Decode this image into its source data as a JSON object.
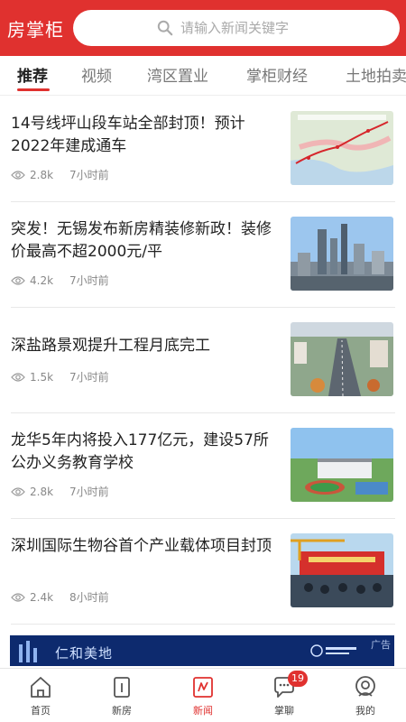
{
  "header": {
    "title": "房掌柜",
    "search_placeholder": "请输入新闻关键字"
  },
  "tabs": [
    {
      "label": "推荐",
      "active": true
    },
    {
      "label": "视频"
    },
    {
      "label": "湾区置业"
    },
    {
      "label": "掌柜财经"
    },
    {
      "label": "土地拍卖"
    }
  ],
  "articles": [
    {
      "title": "14号线坪山段车站全部封顶！预计2022年建成通车",
      "views": "2.8k",
      "time": "7小时前",
      "image": "map-thumbnail"
    },
    {
      "title": "突发！无锡发布新房精装修新政！装修价最高不超2000元/平",
      "views": "4.2k",
      "time": "7小时前",
      "image": "city-skyline-thumbnail"
    },
    {
      "title": "深盐路景观提升工程月底完工",
      "views": "1.5k",
      "time": "7小时前",
      "image": "road-aerial-thumbnail"
    },
    {
      "title": "龙华5年内将投入177亿元，建设57所公办义务教育学校",
      "views": "2.8k",
      "time": "7小时前",
      "image": "school-aerial-thumbnail"
    },
    {
      "title": "深圳国际生物谷首个产业载体项目封顶",
      "views": "2.4k",
      "time": "8小时前",
      "image": "ceremony-thumbnail"
    }
  ],
  "ad": {
    "brand": "仁和美地",
    "tag": "广告"
  },
  "bottom_nav": [
    {
      "label": "首页",
      "icon": "home-icon"
    },
    {
      "label": "新房",
      "icon": "building-icon"
    },
    {
      "label": "新闻",
      "icon": "news-icon",
      "active": true
    },
    {
      "label": "掌聊",
      "icon": "chat-icon",
      "badge": "19"
    },
    {
      "label": "我的",
      "icon": "profile-icon"
    }
  ],
  "colors": {
    "brand": "#e0312f",
    "text": "#222222",
    "meta": "#888888"
  }
}
